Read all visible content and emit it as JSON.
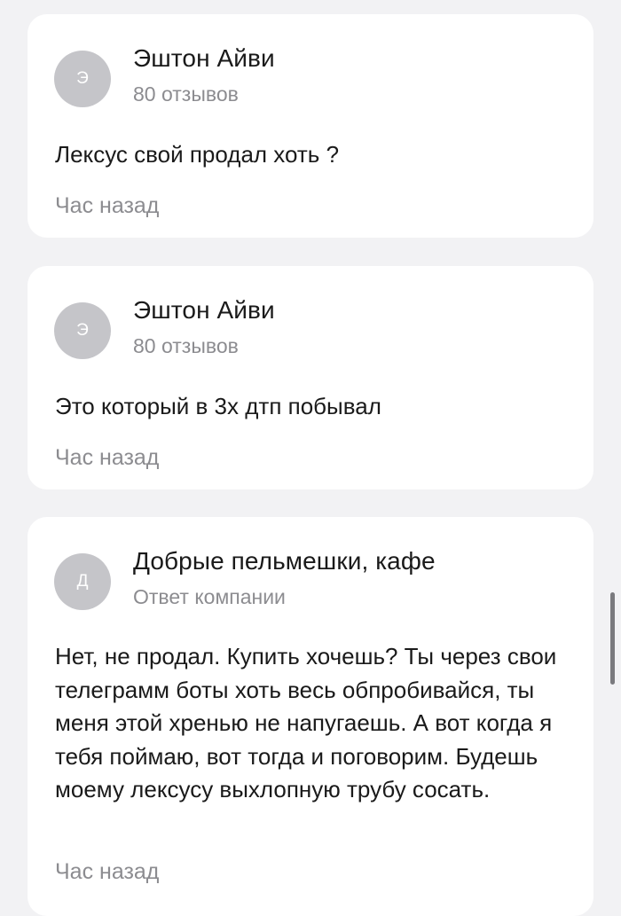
{
  "comments": [
    {
      "avatar_letter": "Э",
      "author": "Эштон Айви",
      "subtitle": "80 отзывов",
      "text": "Лексус свой продал хоть ?",
      "time": "Час назад"
    },
    {
      "avatar_letter": "Э",
      "author": "Эштон Айви",
      "subtitle": "80 отзывов",
      "text": "Это который в 3х дтп побывал",
      "time": "Час назад"
    },
    {
      "avatar_letter": "Д",
      "author": "Добрые пельмешки, кафе",
      "subtitle": "Ответ компании",
      "text": "Нет, не продал. Купить хочешь? Ты через свои телеграмм боты хоть весь обпробивайся, ты меня этой хренью не напугаешь. А вот когда я тебя поймаю, вот тогда и поговорим. Будешь моему лексусу выхлопную трубу сосать.",
      "time": "Час назад"
    }
  ],
  "colors": {
    "background": "#f2f2f4",
    "card": "#ffffff",
    "avatar": "#c5c5c9",
    "secondary_text": "#8c8c90",
    "primary_text": "#1a1a1a"
  }
}
